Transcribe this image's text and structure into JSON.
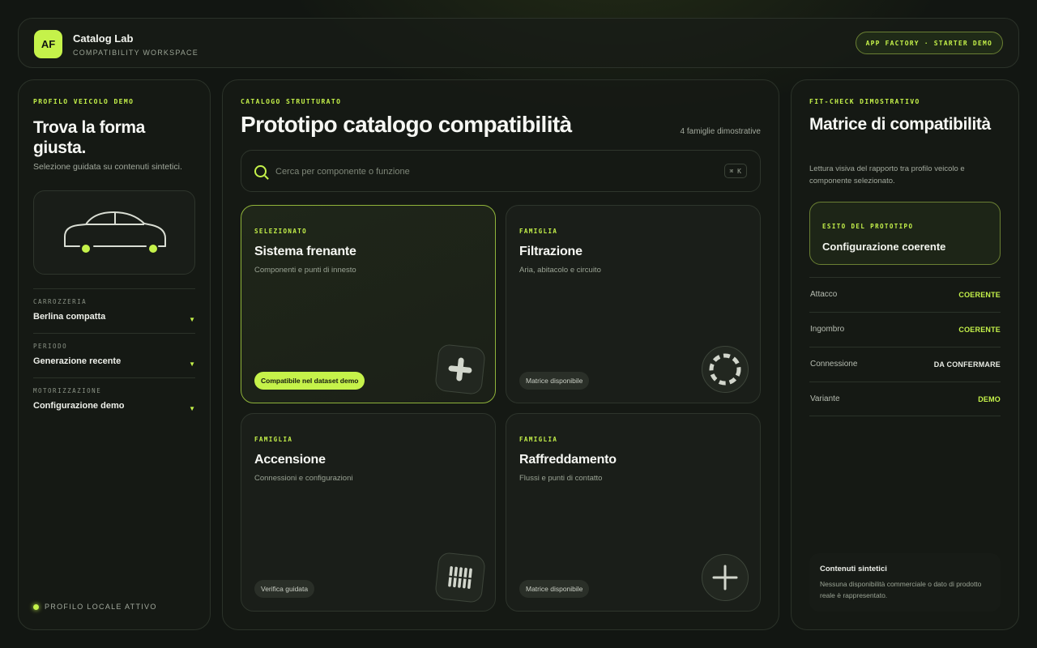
{
  "header": {
    "logo_initials": "AF",
    "app_title": "Catalog Lab",
    "app_subtitle": "COMPATIBILITY WORKSPACE",
    "badge": "APP FACTORY · STARTER DEMO"
  },
  "colors": {
    "accent": "#c5f24a",
    "background": "#121612",
    "panel": "#161a15"
  },
  "left": {
    "eyebrow": "PROFILO VEICOLO DEMO",
    "title": "Trova la forma giusta.",
    "subtitle": "Selezione guidata su contenuti sintetici.",
    "car_icon": "car-outline-icon",
    "fields": [
      {
        "label": "CARROZZERIA",
        "value": "Berlina compatta"
      },
      {
        "label": "PERIODO",
        "value": "Generazione recente"
      },
      {
        "label": "MOTORIZZAZIONE",
        "value": "Configurazione demo"
      }
    ],
    "status": "PROFILO LOCALE ATTIVO"
  },
  "main": {
    "eyebrow": "CATALOGO STRUTTURATO",
    "title": "Prototipo catalogo compatibilità",
    "count": "4 famiglie dimostrative",
    "search": {
      "placeholder": "Cerca per componente o funzione",
      "value": "",
      "shortcut": "⌘ K"
    },
    "cards": [
      {
        "eyebrow": "SELEZIONATO",
        "title": "Sistema frenante",
        "desc": "Componenti e punti di innesto",
        "badge": "Compatibile nel dataset demo",
        "icon": "plus-icon"
      },
      {
        "eyebrow": "FAMIGLIA",
        "title": "Filtrazione",
        "desc": "Aria, abitacolo e circuito",
        "badge": "Matrice disponibile",
        "icon": "dashed-circle-icon"
      },
      {
        "eyebrow": "FAMIGLIA",
        "title": "Accensione",
        "desc": "Connessioni e configurazioni",
        "badge": "Verifica guidata",
        "icon": "grille-icon"
      },
      {
        "eyebrow": "FAMIGLIA",
        "title": "Raffreddamento",
        "desc": "Flussi e punti di contatto",
        "badge": "Matrice disponibile",
        "icon": "plus-icon"
      }
    ]
  },
  "right": {
    "eyebrow": "FIT-CHECK DIMOSTRATIVO",
    "title": "Matrice di compatibilità",
    "subtitle": "Lettura visiva del rapporto tra profilo veicolo e componente selezionato.",
    "result": {
      "label": "ESITO DEL PROTOTIPO",
      "value": "Configurazione coerente"
    },
    "rows": [
      {
        "label": "Attacco",
        "value": "COERENTE"
      },
      {
        "label": "Ingombro",
        "value": "COERENTE"
      },
      {
        "label": "Connessione",
        "value": "DA CONFERMARE"
      },
      {
        "label": "Variante",
        "value": "DEMO"
      }
    ],
    "note": {
      "title": "Contenuti sintetici",
      "text": "Nessuna disponibilità commerciale o dato di prodotto reale è rappresentato."
    }
  }
}
